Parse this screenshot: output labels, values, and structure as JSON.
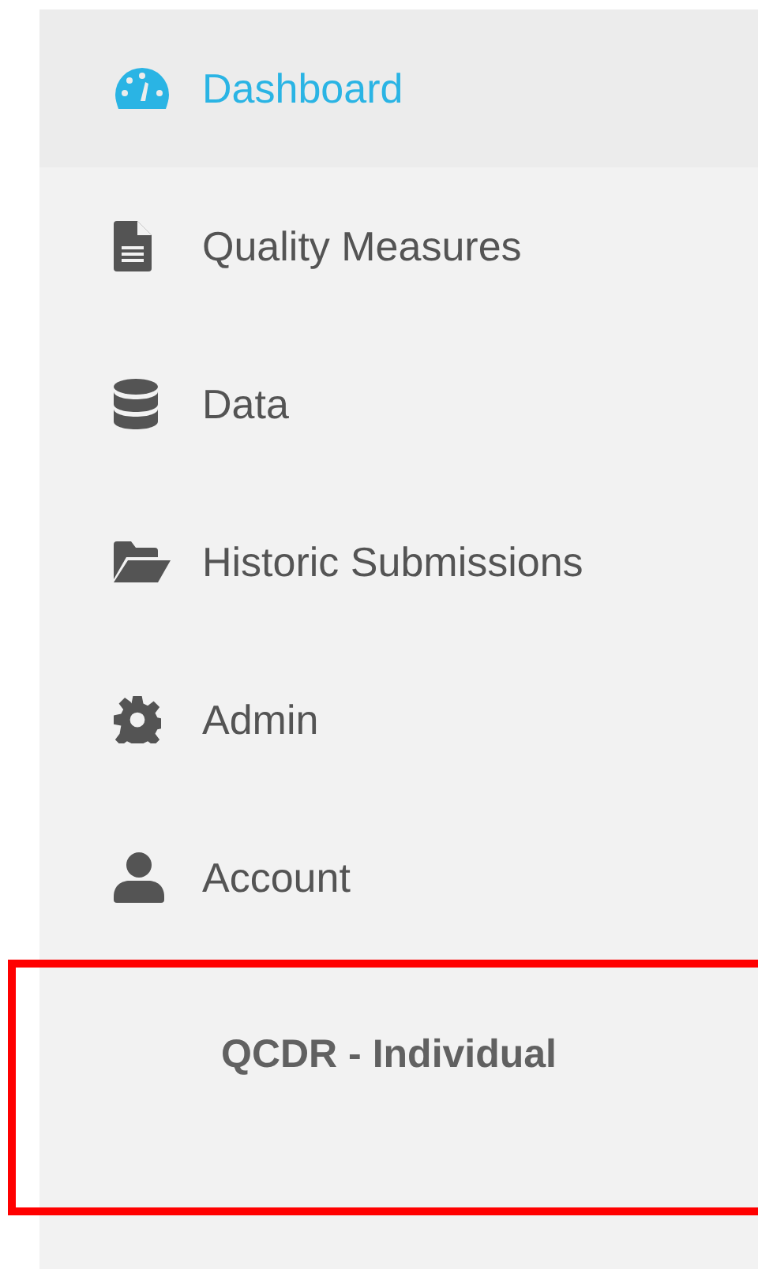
{
  "nav": {
    "items": [
      {
        "label": "Dashboard",
        "selected": true
      },
      {
        "label": "Quality Measures",
        "selected": false
      },
      {
        "label": "Data",
        "selected": false
      },
      {
        "label": "Historic Submissions",
        "selected": false
      },
      {
        "label": "Admin",
        "selected": false
      },
      {
        "label": "Account",
        "selected": false
      }
    ]
  },
  "context": {
    "label": "QCDR - Individual",
    "highlighted": true
  }
}
